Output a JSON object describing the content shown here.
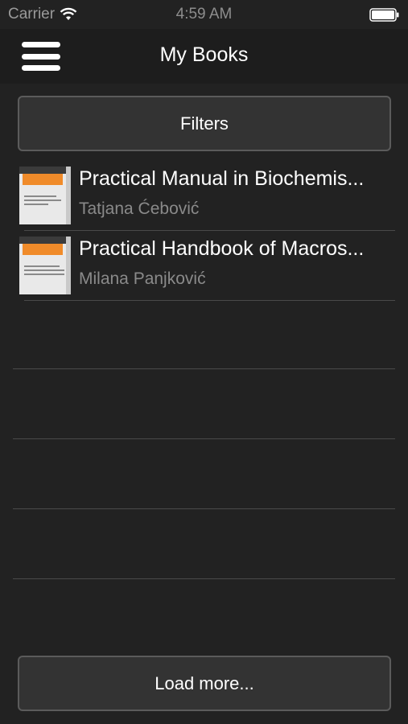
{
  "status_bar": {
    "carrier": "Carrier",
    "time": "4:59 AM",
    "wifi_icon": "wifi-icon",
    "battery_icon": "battery-full-icon"
  },
  "nav": {
    "title": "My Books",
    "menu_icon": "hamburger-menu-icon"
  },
  "filters_label": "Filters",
  "books": [
    {
      "title": "Practical Manual in Biochemis...",
      "author": "Tatjana Ćebović"
    },
    {
      "title": "Practical Handbook of Macros...",
      "author": "Milana Panjković"
    }
  ],
  "load_more_label": "Load more...",
  "colors": {
    "background": "#222222",
    "nav_background": "#1d1d1d",
    "button_background": "#333333",
    "button_border": "#5b5b5b",
    "author_text": "#8a8a8a",
    "cover_accent": "#f08b2a"
  }
}
